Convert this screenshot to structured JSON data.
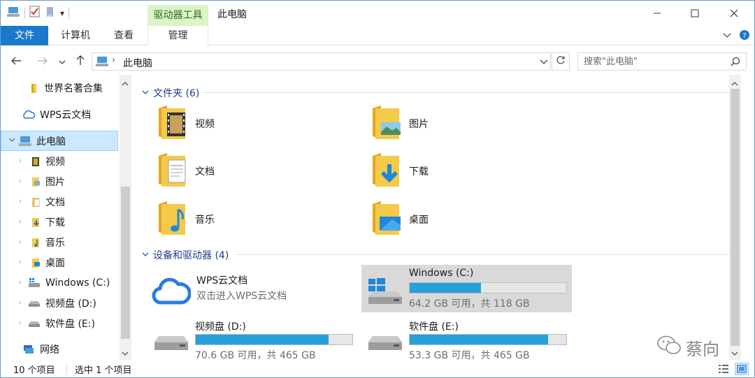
{
  "titlebar": {
    "context_tab_header": "驱动器工具",
    "title": "此电脑",
    "qat_dropdown": "▾"
  },
  "ribbon": {
    "tabs": [
      {
        "label": "文件"
      },
      {
        "label": "计算机"
      },
      {
        "label": "查看"
      },
      {
        "label": "管理"
      }
    ]
  },
  "address": {
    "path": "此电脑",
    "separator": "›",
    "search_placeholder": "搜索\"此电脑\""
  },
  "navpane": {
    "items": [
      {
        "label": "世界名著合集"
      },
      {
        "label": "WPS云文档"
      },
      {
        "label": "此电脑"
      },
      {
        "label": "视频"
      },
      {
        "label": "图片"
      },
      {
        "label": "文档"
      },
      {
        "label": "下载"
      },
      {
        "label": "音乐"
      },
      {
        "label": "桌面"
      },
      {
        "label": "Windows (C:)"
      },
      {
        "label": "视频盘 (D:)"
      },
      {
        "label": "软件盘 (E:)"
      },
      {
        "label": "网络"
      }
    ]
  },
  "content": {
    "folders_group": "文件夹 (6)",
    "folders": [
      {
        "label": "视频",
        "icon": "video-folder-icon"
      },
      {
        "label": "图片",
        "icon": "pictures-folder-icon"
      },
      {
        "label": "文档",
        "icon": "documents-folder-icon"
      },
      {
        "label": "下载",
        "icon": "downloads-folder-icon"
      },
      {
        "label": "音乐",
        "icon": "music-folder-icon"
      },
      {
        "label": "桌面",
        "icon": "desktop-folder-icon"
      }
    ],
    "devices_group": "设备和驱动器 (4)",
    "wps": {
      "name": "WPS云文档",
      "sub": "双击进入WPS云文档"
    },
    "drives": [
      {
        "name": "Windows (C:)",
        "sub": "64.2 GB 可用，共 118 GB",
        "used_fraction": 0.456
      },
      {
        "name": "视频盘 (D:)",
        "sub": "70.6 GB 可用，共 465 GB",
        "used_fraction": 0.848
      },
      {
        "name": "软件盘 (E:)",
        "sub": "53.3 GB 可用，共 465 GB",
        "used_fraction": 0.885
      }
    ]
  },
  "status": {
    "count": "10 个项目",
    "selected": "选中 1 个项目"
  },
  "watermark": "蔡向",
  "colors": {
    "accent": "#1979ca",
    "context_tab": "#dcf4c7",
    "selection": "#cce8ff",
    "drive_bar": "#26a0da",
    "folder_yellow": "#f5c94a"
  }
}
